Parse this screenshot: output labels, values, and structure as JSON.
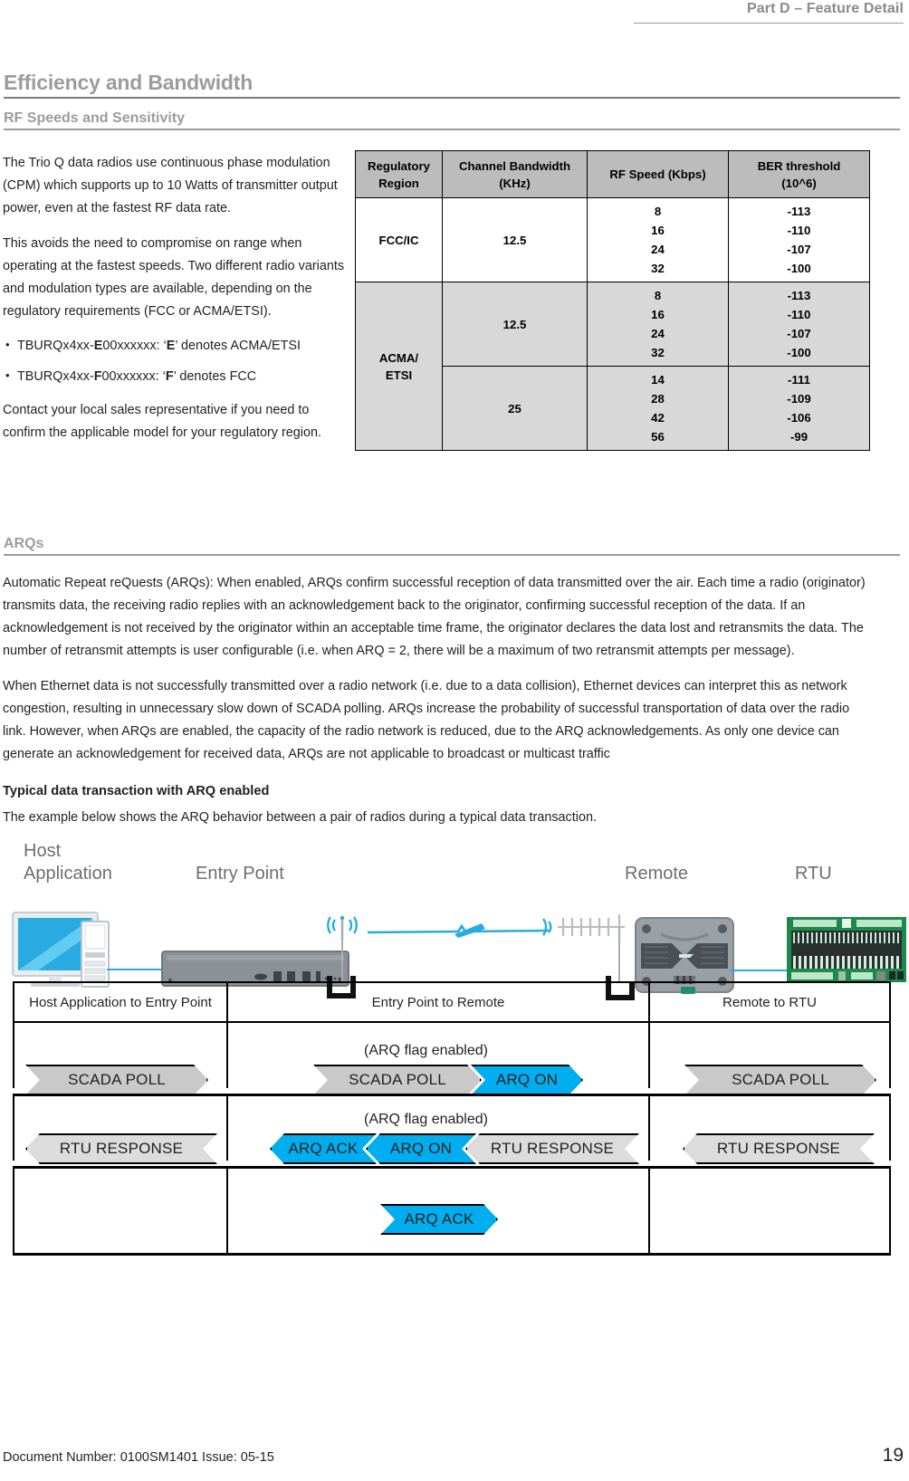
{
  "header": {
    "running_title": "Part D – Feature Detail"
  },
  "sections": {
    "h1": "Efficiency and Bandwidth",
    "h2": "RF Speeds and Sensitivity",
    "arq_heading": "ARQs",
    "arq_sub_heading": "Typical data transaction with ARQ enabled"
  },
  "left_column": {
    "p1": "The Trio Q data radios use continuous phase modulation (CPM) which supports up to 10 Watts of transmitter output power, even at the fastest RF data rate.",
    "p2": "This avoids the need to compromise on range when operating at the fastest speeds. Two different radio variants and modulation types are available, depending on the regulatory requirements (FCC or ACMA/ETSI).",
    "bullet1_pre": "TBURQx4xx-",
    "bullet1_bold1": "E",
    "bullet1_mid": "00xxxxxx: ‘",
    "bullet1_bold2": "E",
    "bullet1_post": "’ denotes ACMA/ETSI",
    "bullet2_pre": "TBURQx4xx-",
    "bullet2_bold1": "F",
    "bullet2_mid": "00xxxxxx: ‘",
    "bullet2_bold2": "F",
    "bullet2_post": "’ denotes FCC",
    "p3": "Contact your local sales representative if you need to confirm the applicable model for your regulatory region."
  },
  "chart_data": {
    "type": "table",
    "title": "RF Speeds and Sensitivity",
    "columns": [
      "Regulatory Region",
      "Channel Bandwidth (KHz)",
      "RF Speed (Kbps)",
      "BER threshold (10^6)"
    ],
    "rows": [
      {
        "region": "FCC/IC",
        "bandwidth": "12.5",
        "speeds": [
          "8",
          "16",
          "24",
          "32"
        ],
        "ber": [
          "-113",
          "-110",
          "-107",
          "-100"
        ]
      },
      {
        "region": "ACMA/ ETSI",
        "bandwidth": "12.5",
        "speeds": [
          "8",
          "16",
          "24",
          "32"
        ],
        "ber": [
          "-113",
          "-110",
          "-107",
          "-100"
        ]
      },
      {
        "region": "",
        "bandwidth": "25",
        "speeds": [
          "14",
          "28",
          "42",
          "56"
        ],
        "ber": [
          "-111",
          "-109",
          "-106",
          "-99"
        ]
      }
    ]
  },
  "spec_table": {
    "headers": {
      "regulatory_region_l1": "Regulatory",
      "regulatory_region_l2": "Region",
      "channel_bandwidth_l1": "Channel Bandwidth",
      "channel_bandwidth_l2": "(KHz)",
      "rf_speed": "RF Speed (Kbps)",
      "ber_l1": "BER threshold",
      "ber_l2": "(10^6)"
    },
    "r1_region": "FCC/IC",
    "r1_bw": "12.5",
    "r1_speeds": "8\n16\n24\n32",
    "r1_ber": "-113\n-110\n-107\n-100",
    "r2_region": "ACMA/\nETSI",
    "r2_bw": "12.5",
    "r2_speeds": "8\n16\n24\n32",
    "r2_ber": "-113\n-110\n-107\n-100",
    "r3_bw": "25",
    "r3_speeds": "14\n28\n42\n56",
    "r3_ber": "-111\n-109\n-106\n-99"
  },
  "arq": {
    "p1": "Automatic Repeat reQuests (ARQs): When enabled, ARQs confirm successful reception of data transmitted over the air. Each time a radio (originator) transmits data, the receiving radio replies with an acknowledgement back to the originator, confirming successful reception of the data. If an acknowledgement is not received by the originator within an acceptable time frame, the originator declares the data lost and retransmits the data. The number of retransmit attempts is user configurable (i.e. when ARQ = 2, there will be a maximum of two retransmit attempts per message).",
    "p2": "When Ethernet data is not successfully transmitted over a radio network (i.e. due to a data collision), Ethernet devices can interpret this as network congestion, resulting in unnecessary slow down of SCADA polling. ARQs increase the probability of successful transportation of data over the radio link. However, when ARQs are enabled, the capacity of the radio network is reduced, due to the ARQ acknowledgements. As only one device can generate an acknowledgement for received data, ARQs are not applicable to broadcast or multicast traffic",
    "intro": "The example below shows the ARQ behavior between a pair of radios during a typical data transaction."
  },
  "network_figure": {
    "label_host_l1": "Host",
    "label_host_l2": "Application",
    "label_entry_point": "Entry Point",
    "label_remote": "Remote",
    "label_rtu": "RTU"
  },
  "sequence": {
    "col1_header": "Host Application to Entry Point",
    "col2_header": "Entry Point to Remote",
    "col3_header": "Remote to RTU",
    "note_row1": "(ARQ flag enabled)",
    "note_row2": "(ARQ flag enabled)",
    "row1": {
      "c1_label": "SCADA POLL",
      "c2_label_a": "SCADA POLL",
      "c2_label_b": "ARQ ON",
      "c3_label": "SCADA POLL"
    },
    "row2": {
      "c1_label": "RTU RESPONSE",
      "c2_label_a": "ARQ ACK",
      "c2_label_b": "ARQ ON",
      "c2_label_c": "RTU RESPONSE",
      "c3_label": "RTU RESPONSE"
    },
    "row3": {
      "c2_label": "ARQ ACK"
    }
  },
  "footer": {
    "document_line": "Document Number: 0100SM1401   Issue: 05-15",
    "page_number": "19"
  },
  "colors": {
    "accent_blue": "#00AEEF",
    "wire_blue": "#29ABE2",
    "heading_grey": "#9C9C9F",
    "table_header_grey": "#BCBCBC",
    "table_row_grey": "#D8D8D8"
  }
}
